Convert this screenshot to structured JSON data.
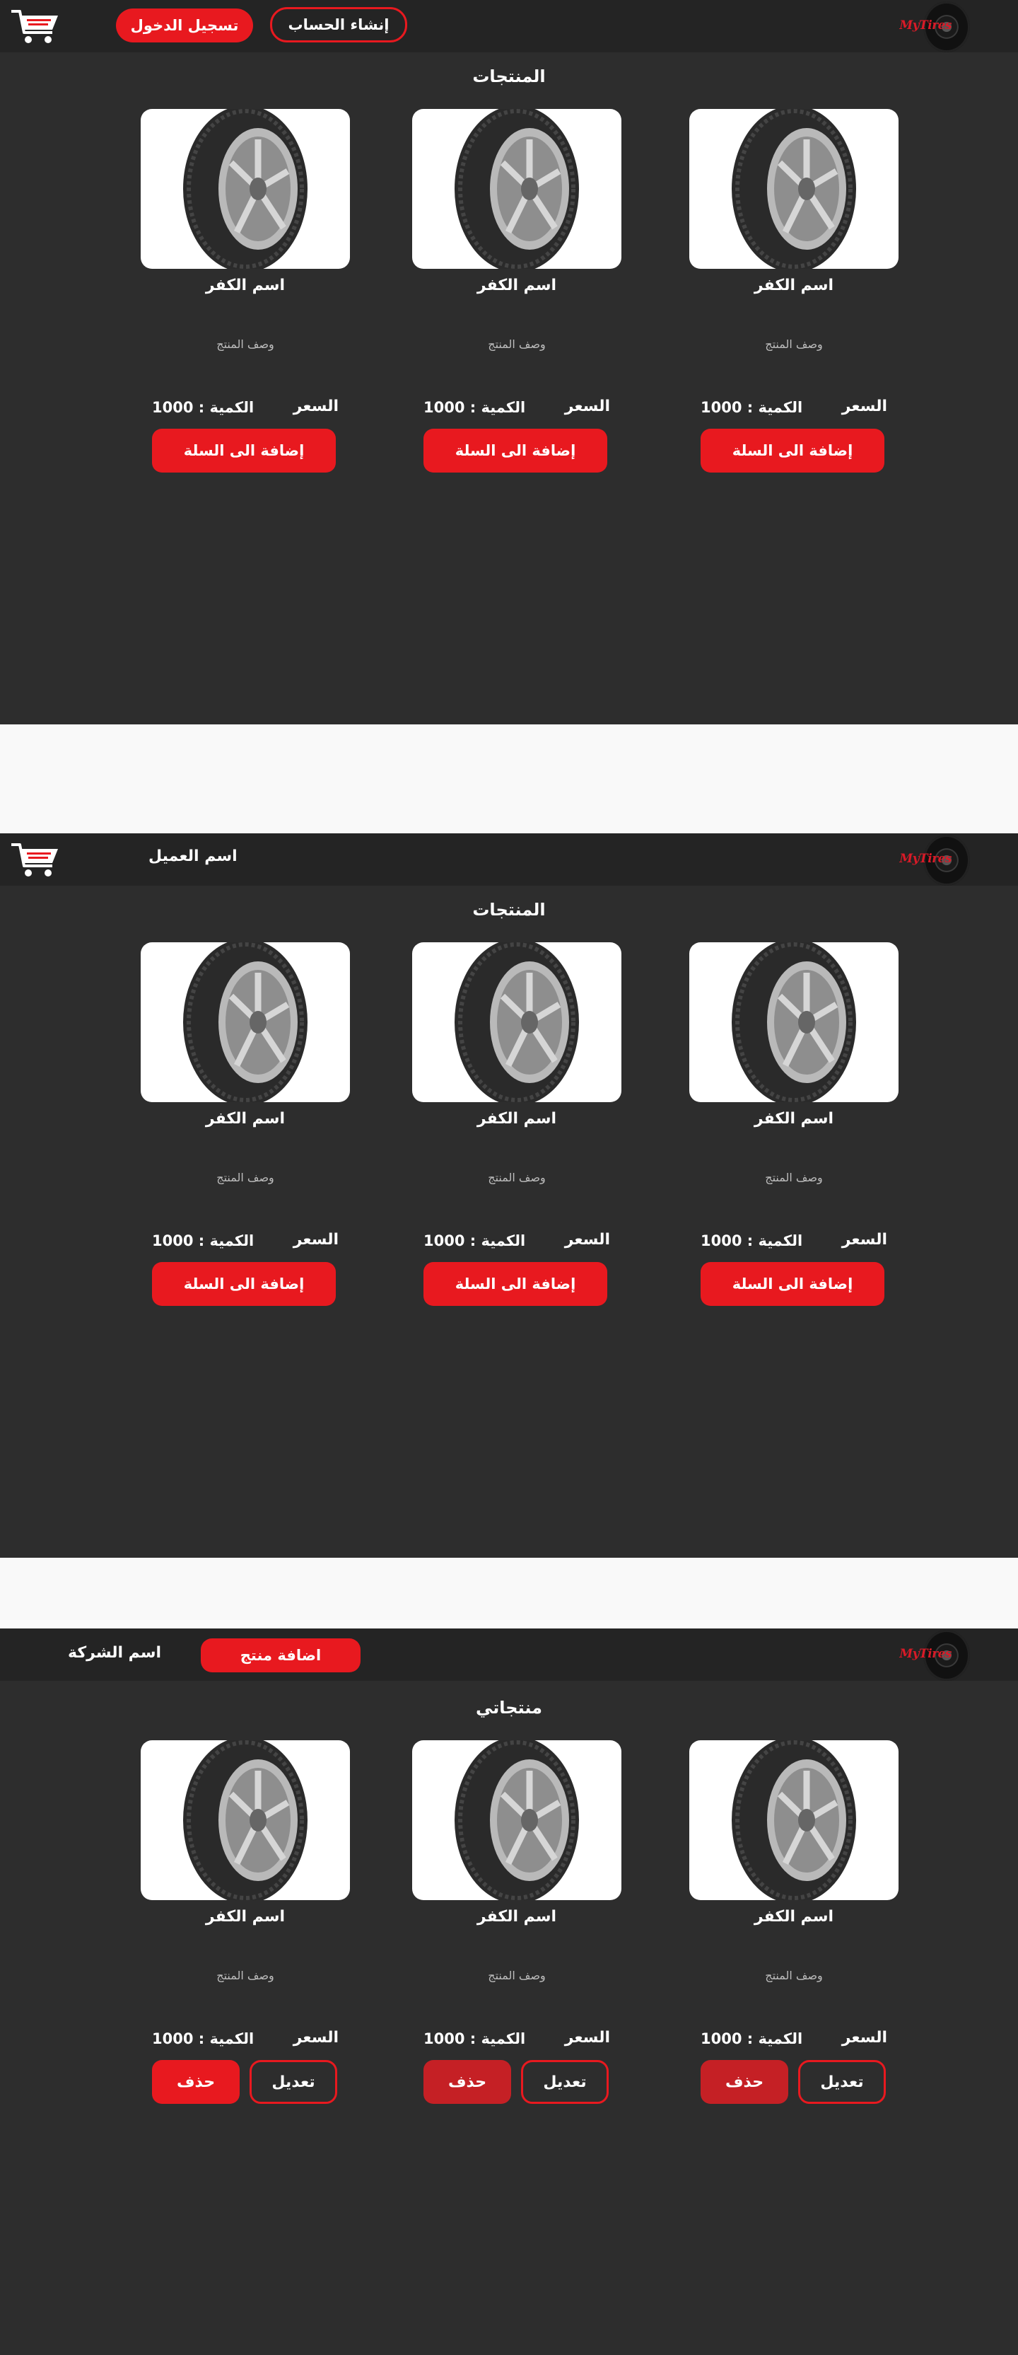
{
  "brand": {
    "logo_text": "MyTires",
    "accent": "#e8191f"
  },
  "screen1": {
    "nav": {
      "signup_label": "إنشاء الحساب",
      "login_label": "تسجيل الدخول"
    },
    "title": "المنتجات",
    "products": [
      {
        "name": "اسم الكفر",
        "desc": "وصف المنتج",
        "price_label": "السعر",
        "qty": "الكمية : 1000",
        "action": "إضافة الى السلة"
      },
      {
        "name": "اسم الكفر",
        "desc": "وصف المنتج",
        "price_label": "السعر",
        "qty": "الكمية : 1000",
        "action": "إضافة الى السلة"
      },
      {
        "name": "اسم الكفر",
        "desc": "وصف المنتج",
        "price_label": "السعر",
        "qty": "الكمية : 1000",
        "action": "إضافة الى السلة"
      }
    ]
  },
  "screen2": {
    "nav": {
      "customer_name": "اسم العميل"
    },
    "title": "المنتجات",
    "products": [
      {
        "name": "اسم الكفر",
        "desc": "وصف المنتج",
        "price_label": "السعر",
        "qty": "الكمية : 1000",
        "action": "إضافة الى السلة"
      },
      {
        "name": "اسم الكفر",
        "desc": "وصف المنتج",
        "price_label": "السعر",
        "qty": "الكمية : 1000",
        "action": "إضافة الى السلة"
      },
      {
        "name": "اسم الكفر",
        "desc": "وصف المنتج",
        "price_label": "السعر",
        "qty": "الكمية : 1000",
        "action": "إضافة الى السلة"
      }
    ]
  },
  "screen3": {
    "nav": {
      "add_product_label": "اضافة منتج",
      "company_name": "اسم الشركة"
    },
    "title": "منتجاتي",
    "products": [
      {
        "name": "اسم الكفر",
        "desc": "وصف المنتج",
        "price_label": "السعر",
        "qty": "الكمية : 1000",
        "edit": "تعديل",
        "delete": "حذف"
      },
      {
        "name": "اسم الكفر",
        "desc": "وصف المنتج",
        "price_label": "السعر",
        "qty": "الكمية : 1000",
        "edit": "تعديل",
        "delete": "حذف"
      },
      {
        "name": "اسم الكفر",
        "desc": "وصف المنتج",
        "price_label": "السعر",
        "qty": "الكمية : 1000",
        "edit": "تعديل",
        "delete": "حذف"
      }
    ]
  }
}
